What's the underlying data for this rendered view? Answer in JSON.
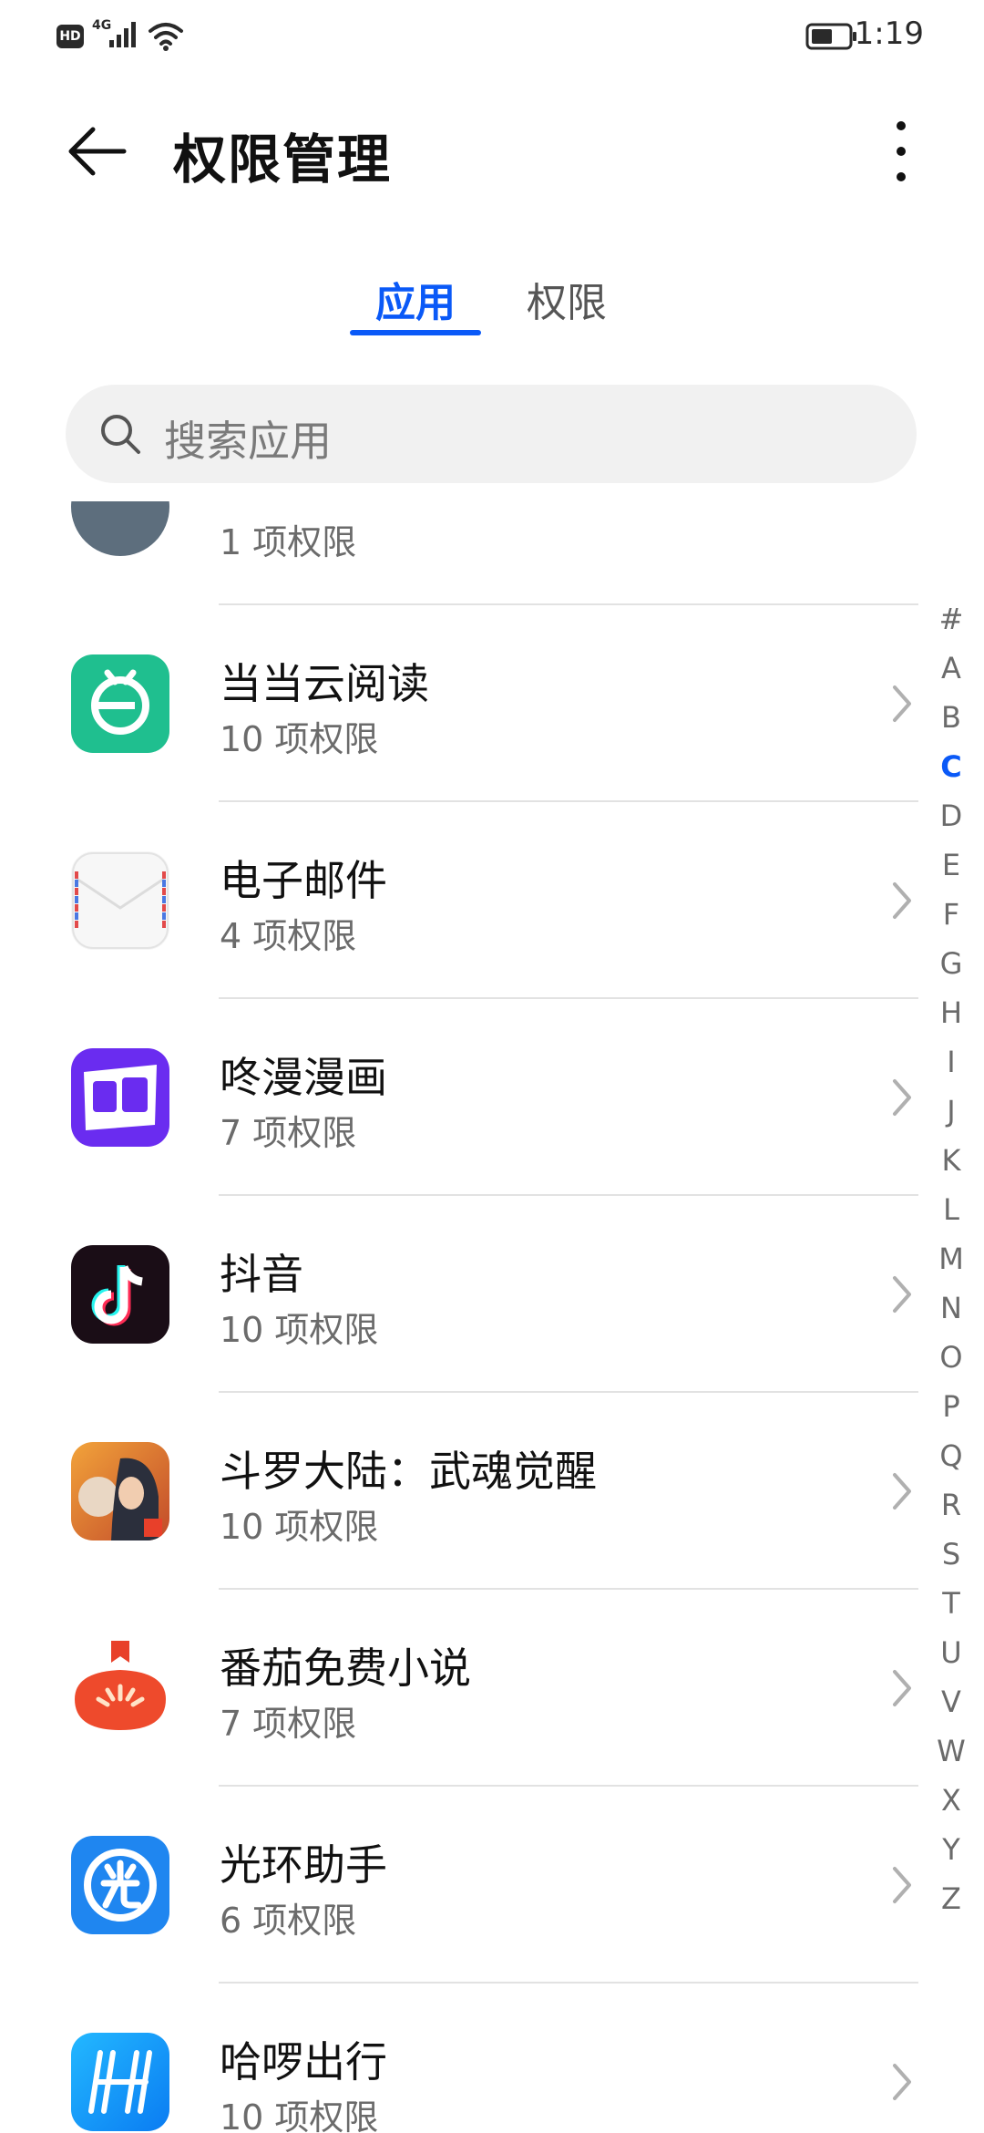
{
  "status_bar": {
    "hd_label": "HD",
    "network_label": "4G",
    "time": "1:19",
    "icons": [
      "hd-icon",
      "signal-icon",
      "wifi-icon",
      "battery-icon"
    ]
  },
  "header": {
    "title": "权限管理",
    "back_icon": "arrow-left-icon",
    "more_icon": "more-vertical-icon"
  },
  "tabs": [
    {
      "label": "应用",
      "active": true
    },
    {
      "label": "权限",
      "active": false
    }
  ],
  "search": {
    "placeholder": "搜索应用",
    "icon": "search-icon"
  },
  "app_list": [
    {
      "name": "",
      "permissions": "1 项权限",
      "icon": "partial-app-icon"
    },
    {
      "name": "当当云阅读",
      "permissions": "10 项权限",
      "icon": "dangdang-reader-icon"
    },
    {
      "name": "电子邮件",
      "permissions": "4 项权限",
      "icon": "email-icon"
    },
    {
      "name": "咚漫漫画",
      "permissions": "7 项权限",
      "icon": "dongman-comics-icon"
    },
    {
      "name": "抖音",
      "permissions": "10 项权限",
      "icon": "douyin-icon"
    },
    {
      "name": "斗罗大陆：武魂觉醒",
      "permissions": "10 项权限",
      "icon": "douluo-game-icon"
    },
    {
      "name": "番茄免费小说",
      "permissions": "7 项权限",
      "icon": "tomato-novel-icon"
    },
    {
      "name": "光环助手",
      "permissions": "6 项权限",
      "icon": "halo-assistant-icon"
    },
    {
      "name": "哈啰出行",
      "permissions": "10 项权限",
      "icon": "hello-travel-icon"
    }
  ],
  "alphabet_index": {
    "letters": [
      "#",
      "A",
      "B",
      "C",
      "D",
      "E",
      "F",
      "G",
      "H",
      "I",
      "J",
      "K",
      "L",
      "M",
      "N",
      "O",
      "P",
      "Q",
      "R",
      "S",
      "T",
      "U",
      "V",
      "W",
      "X",
      "Y",
      "Z"
    ],
    "active": "C"
  },
  "colors": {
    "accent": "#0a59f7",
    "title_text": "#111111",
    "secondary_text": "#6b6b6b",
    "search_background": "#f1f1f1",
    "divider": "#e2e2e2"
  }
}
